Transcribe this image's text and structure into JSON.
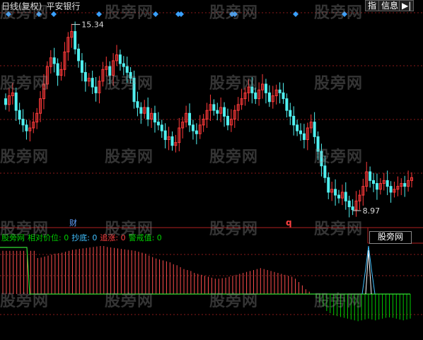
{
  "header": {
    "period": "日线(复权)",
    "stock_name": "平安银行",
    "btn_index": "指",
    "btn_info": "信息",
    "btn_nav": "▶|"
  },
  "indicator_line": {
    "name": "股旁网",
    "label_rel": "相对价位: 0",
    "label_bottom": "抄底: 0",
    "label_chase": "追涨: 0",
    "label_warn": "警戒值: 0"
  },
  "markers": {
    "cai": "财",
    "q": "q"
  },
  "site_box": "股旁网",
  "watermark": "股旁网",
  "colors": {
    "up": "#ff3a3a",
    "down": "#50f0f0",
    "grid": "#8a1a1a",
    "diamond": "#3aa0ff",
    "green_hist": "#00cc00",
    "red_hist": "#ff4d4d"
  },
  "chart_data": [
    {
      "type": "candlestick",
      "high_label": "15.34",
      "low_label": "8.97",
      "note": "upper pane: daily candles",
      "closes": [
        12.6,
        12.9,
        13.0,
        12.4,
        12.1,
        11.9,
        11.7,
        11.8,
        12.0,
        12.3,
        12.8,
        13.3,
        13.9,
        14.2,
        14.0,
        13.6,
        13.8,
        14.4,
        14.9,
        15.1,
        14.5,
        14.1,
        13.7,
        13.4,
        13.5,
        13.2,
        13.0,
        13.4,
        13.8,
        13.9,
        13.6,
        14.1,
        14.3,
        14.0,
        13.9,
        13.7,
        13.5,
        12.7,
        12.5,
        12.3,
        12.5,
        12.1,
        12.3,
        12.0,
        11.9,
        11.7,
        11.4,
        11.5,
        11.2,
        11.3,
        11.8,
        12.0,
        12.3,
        11.9,
        11.7,
        11.6,
        11.9,
        12.1,
        12.4,
        12.6,
        12.4,
        12.3,
        12.5,
        12.2,
        11.9,
        12.1,
        12.4,
        12.6,
        12.8,
        13.0,
        13.2,
        13.0,
        12.8,
        13.1,
        13.3,
        13.0,
        12.7,
        12.9,
        13.1,
        13.0,
        12.8,
        12.4,
        12.2,
        11.9,
        11.7,
        11.6,
        11.4,
        11.8,
        12.0,
        11.5,
        11.0,
        10.5,
        10.1,
        9.6,
        9.7,
        9.5,
        9.4,
        9.6,
        9.3,
        9.1,
        9.0,
        9.3,
        9.5,
        9.8,
        10.3,
        10.0,
        9.9,
        9.7,
        9.9,
        10.0,
        9.8,
        9.6,
        9.7,
        9.8,
        9.9,
        9.8,
        10.0,
        10.1
      ]
    },
    {
      "type": "bar",
      "note": "lower pane: indicator histogram (positive red / negative green)",
      "values": [
        0.9,
        0.9,
        0.9,
        0.9,
        0.9,
        0.9,
        0.9,
        0.9,
        0.9,
        0.9,
        0.75,
        0.76,
        0.78,
        0.8,
        0.82,
        0.84,
        0.85,
        0.86,
        0.88,
        0.9,
        0.92,
        0.93,
        0.94,
        0.95,
        0.96,
        0.97,
        0.98,
        0.99,
        1.0,
        1.0,
        0.98,
        0.97,
        0.96,
        0.95,
        0.94,
        0.93,
        0.92,
        0.91,
        0.9,
        0.88,
        0.86,
        0.84,
        0.8,
        0.77,
        0.74,
        0.72,
        0.7,
        0.68,
        0.66,
        0.62,
        0.6,
        0.56,
        0.52,
        0.5,
        0.48,
        0.44,
        0.42,
        0.4,
        0.38,
        0.36,
        0.34,
        0.32,
        0.32,
        0.33,
        0.34,
        0.36,
        0.38,
        0.4,
        0.42,
        0.44,
        0.46,
        0.48,
        0.5,
        0.52,
        0.54,
        0.52,
        0.5,
        0.48,
        0.46,
        0.44,
        0.42,
        0.4,
        0.38,
        0.36,
        0.32,
        0.25,
        0.18,
        0.1,
        0.05,
        0,
        -0.1,
        -0.2,
        -0.3,
        -0.4,
        -0.45,
        -0.5,
        -0.52,
        -0.54,
        -0.56,
        -0.58,
        -0.6,
        -0.62,
        -0.64,
        -0.62,
        -0.6,
        -0.58,
        -0.6,
        -0.62,
        -0.6,
        -0.58,
        -0.56,
        -0.55,
        -0.56,
        -0.58,
        -0.6,
        -0.62,
        -0.6,
        -0.58
      ]
    }
  ]
}
